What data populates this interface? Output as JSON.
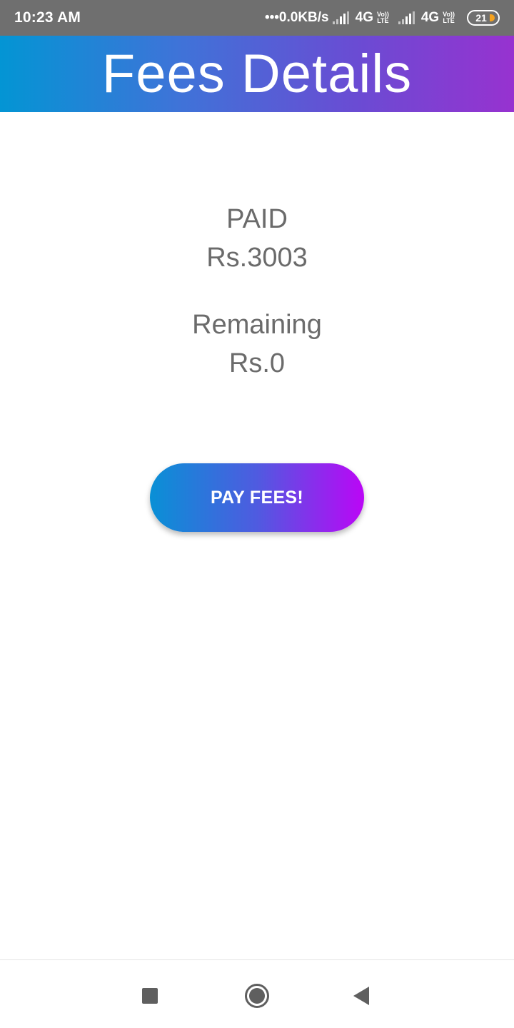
{
  "status_bar": {
    "time": "10:23 AM",
    "network_speed": "•••0.0KB/s",
    "sim1_network": "4G",
    "sim2_network": "4G",
    "volte_top": "Vo))",
    "volte_bottom": "LTE",
    "battery_level": "21"
  },
  "header": {
    "title": "Fees Details"
  },
  "fees": {
    "paid_label": "PAID",
    "paid_amount": "Rs.3003",
    "remaining_label": "Remaining",
    "remaining_amount": "Rs.0"
  },
  "actions": {
    "pay_button_label": "PAY FEES!"
  },
  "nav_bar": {
    "recents_icon": "square-icon",
    "home_icon": "circle-icon",
    "back_icon": "triangle-icon"
  },
  "colors": {
    "header_gradient_start": "#0395d4",
    "header_gradient_end": "#9732d0",
    "button_gradient_start": "#0990d6",
    "button_gradient_end": "#bb06f6",
    "text_gray": "#6b6b6b",
    "status_bar": "#6f6f6f"
  }
}
